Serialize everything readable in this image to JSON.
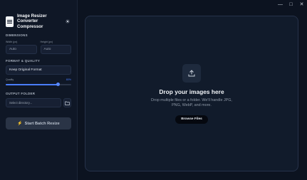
{
  "window": {
    "controls": {
      "minimize": "—",
      "maximize": "□",
      "close": "✕"
    }
  },
  "sidebar": {
    "app_title_line1": "Image Resizer",
    "app_title_line2": "Converter Compressor",
    "theme_icon": "sun-icon",
    "dimensions": {
      "label": "DIMENSIONS",
      "width_caption": "Width (px)",
      "width_value": "Auto",
      "height_caption": "Height (px)",
      "height_value": "Auto"
    },
    "format": {
      "label": "FORMAT & QUALITY",
      "selected": "Keep Original Format",
      "quality_label": "Quality",
      "quality_display": "80%",
      "quality_fraction": 0.8
    },
    "output": {
      "label": "OUTPUT FOLDER",
      "placeholder": "Select directory...",
      "folder_icon": "folder-icon"
    },
    "batch_button": "Start Batch Resize"
  },
  "dropzone": {
    "icon": "upload-icon",
    "title": "Drop your images here",
    "subtitle": "Drop multiple files or a folder. We'll handle JPG, PNG, WebP, and more.",
    "browse": "Browse Files"
  },
  "colors": {
    "accent": "#4a7dff",
    "background": "#0c1320",
    "panel": "#0f1726"
  }
}
